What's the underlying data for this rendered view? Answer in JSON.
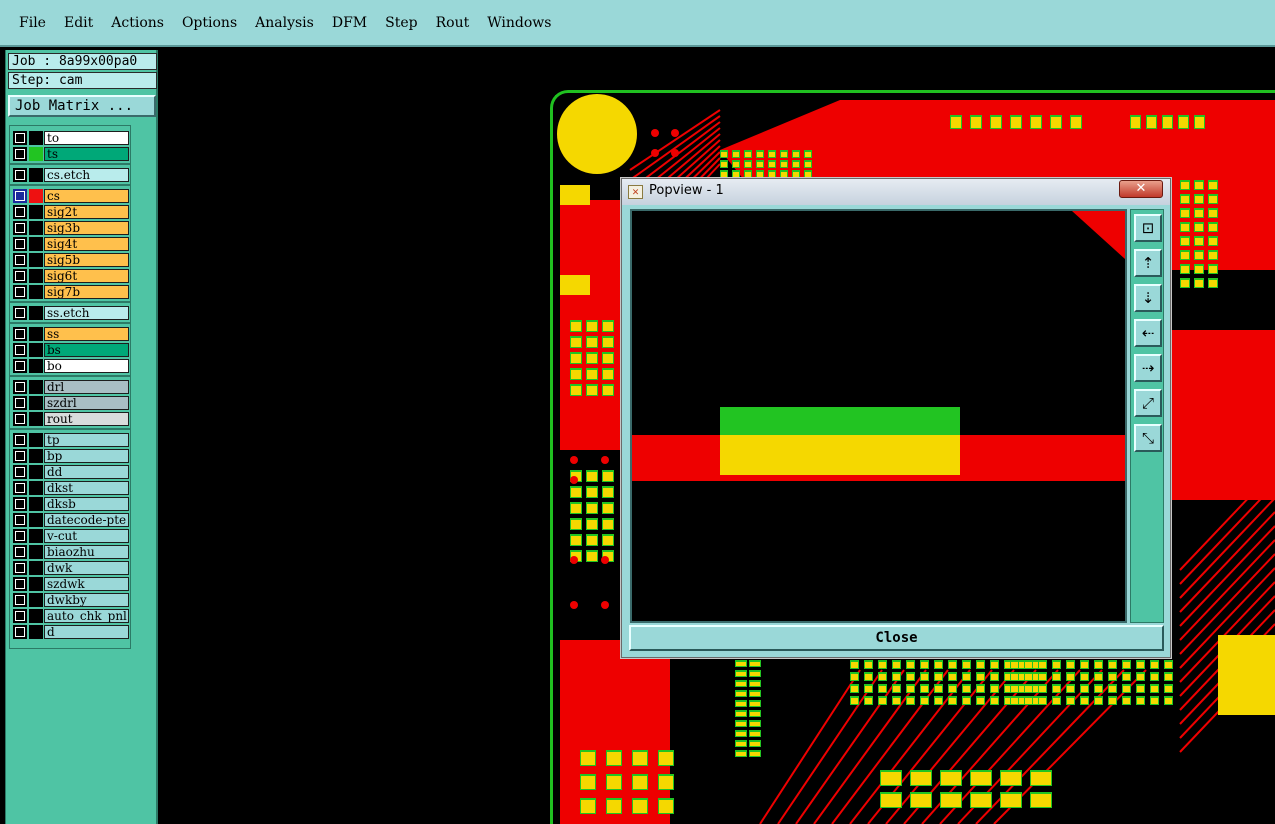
{
  "menu": [
    {
      "label": "File"
    },
    {
      "label": "Edit"
    },
    {
      "label": "Actions"
    },
    {
      "label": "Options"
    },
    {
      "label": "Analysis"
    },
    {
      "label": "DFM"
    },
    {
      "label": "Step"
    },
    {
      "label": "Rout"
    },
    {
      "label": "Windows"
    }
  ],
  "job": {
    "job_label": "Job : 8a99x00pa0",
    "step_label": "Step: cam",
    "matrix_button": "Job Matrix ..."
  },
  "layers": [
    {
      "name": "to",
      "color": "#ffffff",
      "swatch": "#000000"
    },
    {
      "name": "ts",
      "color": "#00a878",
      "swatch": "#22c422"
    },
    {
      "name": "cs.etch",
      "color": "#b9ecec",
      "swatch": "#000000"
    },
    {
      "name": "cs",
      "color": "#ffc04c",
      "swatch": "#ee1111",
      "active": true
    },
    {
      "name": "sig2t",
      "color": "#ffc04c",
      "swatch": "#000000"
    },
    {
      "name": "sig3b",
      "color": "#ffc04c",
      "swatch": "#000000"
    },
    {
      "name": "sig4t",
      "color": "#ffc04c",
      "swatch": "#000000"
    },
    {
      "name": "sig5b",
      "color": "#ffc04c",
      "swatch": "#000000"
    },
    {
      "name": "sig6t",
      "color": "#ffc04c",
      "swatch": "#000000"
    },
    {
      "name": "sig7b",
      "color": "#ffc04c",
      "swatch": "#000000"
    },
    {
      "name": "ss.etch",
      "color": "#b9ecec",
      "swatch": "#000000"
    },
    {
      "name": "ss",
      "color": "#ffc04c",
      "swatch": "#000000"
    },
    {
      "name": "bs",
      "color": "#00a878",
      "swatch": "#000000"
    },
    {
      "name": "bo",
      "color": "#ffffff",
      "swatch": "#000000"
    },
    {
      "name": "drl",
      "color": "#a9bec4",
      "swatch": "#000000"
    },
    {
      "name": "szdrl",
      "color": "#a9bec4",
      "swatch": "#000000"
    },
    {
      "name": "rout",
      "color": "#d8dcdc",
      "swatch": "#000000"
    },
    {
      "name": "tp",
      "color": "#9ad8d8",
      "swatch": "#000000"
    },
    {
      "name": "bp",
      "color": "#9ad8d8",
      "swatch": "#000000"
    },
    {
      "name": "dd",
      "color": "#9ad8d8",
      "swatch": "#000000"
    },
    {
      "name": "dkst",
      "color": "#9ad8d8",
      "swatch": "#000000"
    },
    {
      "name": "dksb",
      "color": "#9ad8d8",
      "swatch": "#000000"
    },
    {
      "name": "datecode-pte",
      "color": "#9ad8d8",
      "swatch": "#000000"
    },
    {
      "name": "v-cut",
      "color": "#9ad8d8",
      "swatch": "#000000"
    },
    {
      "name": "biaozhu",
      "color": "#9ad8d8",
      "swatch": "#000000"
    },
    {
      "name": "dwk",
      "color": "#9ad8d8",
      "swatch": "#000000"
    },
    {
      "name": "szdwk",
      "color": "#9ad8d8",
      "swatch": "#000000"
    },
    {
      "name": "dwkby",
      "color": "#9ad8d8",
      "swatch": "#000000"
    },
    {
      "name": "auto_chk_pnl",
      "color": "#9ad8d8",
      "swatch": "#000000"
    },
    {
      "name": "d",
      "color": "#9ad8d8",
      "swatch": "#000000"
    }
  ],
  "popview": {
    "title": "Popview - 1",
    "close_label": "Close",
    "tools": [
      {
        "icon": "zoom-window-icon"
      },
      {
        "icon": "pan-up-icon"
      },
      {
        "icon": "pan-down-icon"
      },
      {
        "icon": "pan-left-icon"
      },
      {
        "icon": "pan-right-icon"
      },
      {
        "icon": "zoom-in-icon"
      },
      {
        "icon": "zoom-out-icon"
      }
    ]
  },
  "colors": {
    "panel": "#4fc4a4",
    "menubar": "#9ad8d8",
    "copper": "#ee0000",
    "pad": "#f5d800",
    "mask": "#22c422"
  }
}
